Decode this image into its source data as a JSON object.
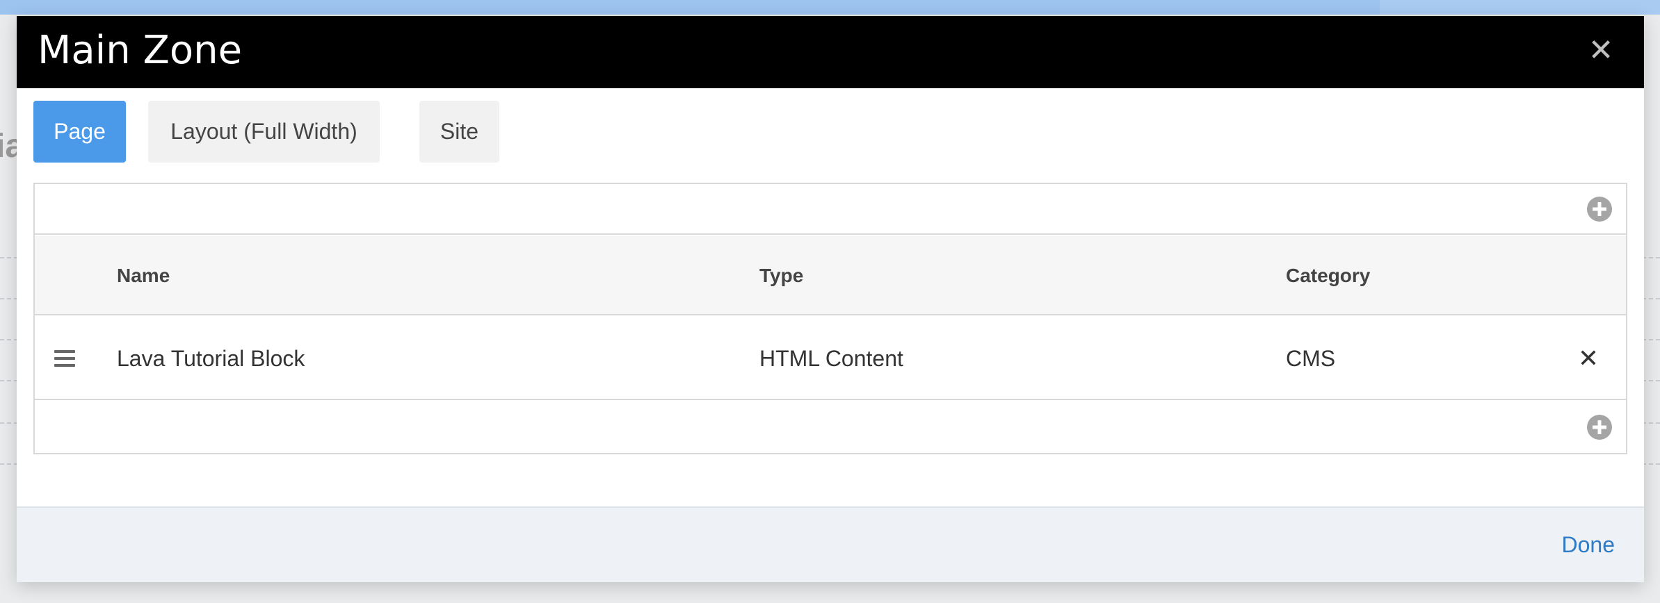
{
  "background": {
    "fragment_text": "ia"
  },
  "modal": {
    "title": "Main Zone",
    "close_symbol": "✕",
    "tabs": [
      {
        "label": "Page",
        "active": true
      },
      {
        "label": "Layout (Full Width)",
        "active": false
      },
      {
        "label": "Site",
        "active": false
      }
    ],
    "grid": {
      "columns": [
        "Name",
        "Type",
        "Category"
      ],
      "rows": [
        {
          "name": "Lava Tutorial Block",
          "type": "HTML Content",
          "category": "CMS"
        }
      ]
    },
    "footer": {
      "done_label": "Done"
    }
  },
  "colors": {
    "header_bg": "#000000",
    "active_tab": "#4a9ae9",
    "link": "#2f7bc5"
  },
  "icons": {
    "close": "close-icon",
    "add": "plus-circle-icon",
    "drag": "bars-icon",
    "delete": "times-icon"
  }
}
